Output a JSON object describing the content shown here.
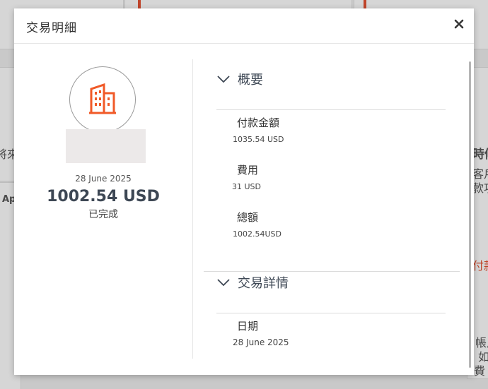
{
  "background": {
    "left_text": "將來",
    "left_text2": "Ap",
    "right_text1": "時候",
    "right_text2": "客戶",
    "right_text3": "款項",
    "right_link": "付款",
    "right_text4": "帳戶",
    "right_text5": "如",
    "right_text6": "費"
  },
  "modal": {
    "title": "交易明細",
    "close_glyph": "✕"
  },
  "transaction": {
    "icon": "building-icon",
    "date": "28 June 2025",
    "amount": "1002.54 USD",
    "status": "已完成"
  },
  "overview": {
    "heading": "概要",
    "fields": [
      {
        "label": "付款金額",
        "value": "1035.54 USD"
      },
      {
        "label": "費用",
        "value": "31 USD"
      },
      {
        "label": "總額",
        "value": "1002.54USD"
      }
    ]
  },
  "details": {
    "heading": "交易詳情",
    "fields": [
      {
        "label": "日期",
        "value": "28 June 2025"
      }
    ]
  },
  "colors": {
    "accent": "#f05a28",
    "heading": "#3d4754"
  }
}
